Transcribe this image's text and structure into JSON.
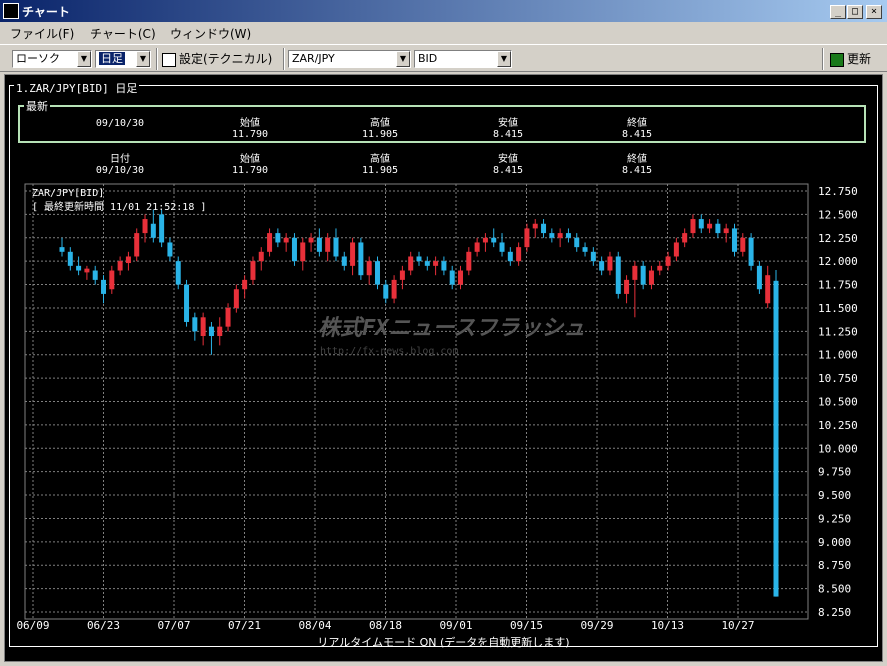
{
  "window": {
    "title": "チャート",
    "minimize": "_",
    "maximize": "□",
    "close": "×"
  },
  "menu": [
    {
      "label": "ファイル(F)"
    },
    {
      "label": "チャート(C)"
    },
    {
      "label": "ウィンドウ(W)"
    }
  ],
  "toolbar": {
    "chart_type": "ローソク",
    "period": "日足",
    "settings_label": "設定(テクニカル)",
    "pair": "ZAR/JPY",
    "price_type": "BID",
    "refresh_label": "更新"
  },
  "chart_header": "1.ZAR/JPY[BID] 日足",
  "latest": {
    "label": "最新",
    "date": "09/10/30",
    "open_label": "始値",
    "open": "11.790",
    "high_label": "高値",
    "high": "11.905",
    "low_label": "安値",
    "low": "8.415",
    "close_label": "終値",
    "close": "8.415"
  },
  "cursor_info": {
    "date_label": "日付",
    "date": "09/10/30",
    "open_label": "始値",
    "open": "11.790",
    "high_label": "高値",
    "high": "11.905",
    "low_label": "安値",
    "low": "8.415",
    "close_label": "終値",
    "close": "8.415"
  },
  "plot": {
    "symbol_label": "ZAR/JPY[BID]",
    "update_time": "[ 最終更新時間 11/01 21:52:18 ]",
    "watermark": "株式FXニュースフラッシュ",
    "watermark_url": "http://fx-news.blog.com"
  },
  "status_bar": "リアルタイムモード ON (データを自動更新します)",
  "colors": {
    "up": "#e8303a",
    "down": "#2ab4e8",
    "grid": "#808080",
    "axis_text": "#ffffff"
  },
  "chart_data": {
    "type": "candlestick",
    "ylim": [
      8.25,
      12.75
    ],
    "y_ticks": [
      "12.750",
      "12.500",
      "12.250",
      "12.000",
      "11.750",
      "11.500",
      "11.250",
      "11.000",
      "10.750",
      "10.500",
      "10.250",
      "10.000",
      "9.750",
      "9.500",
      "9.250",
      "9.000",
      "8.750",
      "8.500",
      "8.250"
    ],
    "x_ticks": [
      "06/09",
      "06/23",
      "07/07",
      "07/21",
      "08/04",
      "08/18",
      "09/01",
      "09/15",
      "09/29",
      "10/13",
      "10/27"
    ],
    "candles": [
      {
        "o": 12.15,
        "h": 12.25,
        "l": 12.05,
        "c": 12.1
      },
      {
        "o": 12.1,
        "h": 12.15,
        "l": 11.9,
        "c": 11.95
      },
      {
        "o": 11.95,
        "h": 12.05,
        "l": 11.85,
        "c": 11.9
      },
      {
        "o": 11.88,
        "h": 11.95,
        "l": 11.8,
        "c": 11.92
      },
      {
        "o": 11.9,
        "h": 11.95,
        "l": 11.75,
        "c": 11.8
      },
      {
        "o": 11.8,
        "h": 11.85,
        "l": 11.55,
        "c": 11.65
      },
      {
        "o": 11.7,
        "h": 11.95,
        "l": 11.65,
        "c": 11.9
      },
      {
        "o": 11.9,
        "h": 12.05,
        "l": 11.85,
        "c": 12.0
      },
      {
        "o": 11.98,
        "h": 12.1,
        "l": 11.9,
        "c": 12.05
      },
      {
        "o": 12.05,
        "h": 12.35,
        "l": 12.0,
        "c": 12.3
      },
      {
        "o": 12.3,
        "h": 12.5,
        "l": 12.2,
        "c": 12.45
      },
      {
        "o": 12.4,
        "h": 12.55,
        "l": 12.2,
        "c": 12.25
      },
      {
        "o": 12.5,
        "h": 12.55,
        "l": 12.15,
        "c": 12.2
      },
      {
        "o": 12.2,
        "h": 12.25,
        "l": 12.0,
        "c": 12.05
      },
      {
        "o": 12.0,
        "h": 12.05,
        "l": 11.7,
        "c": 11.75
      },
      {
        "o": 11.75,
        "h": 11.8,
        "l": 11.3,
        "c": 11.35
      },
      {
        "o": 11.4,
        "h": 11.45,
        "l": 11.15,
        "c": 11.25
      },
      {
        "o": 11.2,
        "h": 11.45,
        "l": 11.1,
        "c": 11.4
      },
      {
        "o": 11.3,
        "h": 11.35,
        "l": 11.0,
        "c": 11.2
      },
      {
        "o": 11.2,
        "h": 11.4,
        "l": 11.1,
        "c": 11.3
      },
      {
        "o": 11.3,
        "h": 11.55,
        "l": 11.25,
        "c": 11.5
      },
      {
        "o": 11.5,
        "h": 11.75,
        "l": 11.45,
        "c": 11.7
      },
      {
        "o": 11.7,
        "h": 11.85,
        "l": 11.6,
        "c": 11.8
      },
      {
        "o": 11.8,
        "h": 12.05,
        "l": 11.75,
        "c": 12.0
      },
      {
        "o": 12.0,
        "h": 12.15,
        "l": 11.9,
        "c": 12.1
      },
      {
        "o": 12.1,
        "h": 12.35,
        "l": 12.05,
        "c": 12.3
      },
      {
        "o": 12.3,
        "h": 12.35,
        "l": 12.15,
        "c": 12.2
      },
      {
        "o": 12.2,
        "h": 12.3,
        "l": 12.1,
        "c": 12.25
      },
      {
        "o": 12.25,
        "h": 12.3,
        "l": 11.95,
        "c": 12.0
      },
      {
        "o": 12.0,
        "h": 12.25,
        "l": 11.9,
        "c": 12.2
      },
      {
        "o": 12.2,
        "h": 12.3,
        "l": 12.1,
        "c": 12.25
      },
      {
        "o": 12.25,
        "h": 12.35,
        "l": 12.05,
        "c": 12.1
      },
      {
        "o": 12.1,
        "h": 12.3,
        "l": 12.0,
        "c": 12.25
      },
      {
        "o": 12.25,
        "h": 12.35,
        "l": 12.0,
        "c": 12.05
      },
      {
        "o": 12.05,
        "h": 12.1,
        "l": 11.9,
        "c": 11.95
      },
      {
        "o": 11.95,
        "h": 12.25,
        "l": 11.85,
        "c": 12.2
      },
      {
        "o": 12.2,
        "h": 12.25,
        "l": 11.8,
        "c": 11.85
      },
      {
        "o": 11.85,
        "h": 12.05,
        "l": 11.75,
        "c": 12.0
      },
      {
        "o": 12.0,
        "h": 12.05,
        "l": 11.7,
        "c": 11.75
      },
      {
        "o": 11.75,
        "h": 11.8,
        "l": 11.55,
        "c": 11.6
      },
      {
        "o": 11.6,
        "h": 11.85,
        "l": 11.55,
        "c": 11.8
      },
      {
        "o": 11.8,
        "h": 11.95,
        "l": 11.7,
        "c": 11.9
      },
      {
        "o": 11.9,
        "h": 12.1,
        "l": 11.85,
        "c": 12.05
      },
      {
        "o": 12.05,
        "h": 12.1,
        "l": 11.95,
        "c": 12.0
      },
      {
        "o": 12.0,
        "h": 12.05,
        "l": 11.9,
        "c": 11.95
      },
      {
        "o": 11.95,
        "h": 12.05,
        "l": 11.85,
        "c": 12.0
      },
      {
        "o": 12.0,
        "h": 12.05,
        "l": 11.85,
        "c": 11.9
      },
      {
        "o": 11.9,
        "h": 11.95,
        "l": 11.7,
        "c": 11.75
      },
      {
        "o": 11.75,
        "h": 11.95,
        "l": 11.7,
        "c": 11.9
      },
      {
        "o": 11.9,
        "h": 12.15,
        "l": 11.85,
        "c": 12.1
      },
      {
        "o": 12.1,
        "h": 12.25,
        "l": 12.05,
        "c": 12.2
      },
      {
        "o": 12.2,
        "h": 12.3,
        "l": 12.1,
        "c": 12.25
      },
      {
        "o": 12.25,
        "h": 12.35,
        "l": 12.15,
        "c": 12.2
      },
      {
        "o": 12.2,
        "h": 12.3,
        "l": 12.05,
        "c": 12.1
      },
      {
        "o": 12.1,
        "h": 12.15,
        "l": 11.95,
        "c": 12.0
      },
      {
        "o": 12.0,
        "h": 12.2,
        "l": 11.95,
        "c": 12.15
      },
      {
        "o": 12.15,
        "h": 12.4,
        "l": 12.1,
        "c": 12.35
      },
      {
        "o": 12.35,
        "h": 12.45,
        "l": 12.25,
        "c": 12.4
      },
      {
        "o": 12.4,
        "h": 12.45,
        "l": 12.25,
        "c": 12.3
      },
      {
        "o": 12.3,
        "h": 12.35,
        "l": 12.2,
        "c": 12.25
      },
      {
        "o": 12.25,
        "h": 12.35,
        "l": 12.15,
        "c": 12.3
      },
      {
        "o": 12.3,
        "h": 12.35,
        "l": 12.2,
        "c": 12.25
      },
      {
        "o": 12.25,
        "h": 12.3,
        "l": 12.1,
        "c": 12.15
      },
      {
        "o": 12.15,
        "h": 12.2,
        "l": 12.05,
        "c": 12.1
      },
      {
        "o": 12.1,
        "h": 12.15,
        "l": 11.95,
        "c": 12.0
      },
      {
        "o": 12.0,
        "h": 12.05,
        "l": 11.85,
        "c": 11.9
      },
      {
        "o": 11.9,
        "h": 12.1,
        "l": 11.85,
        "c": 12.05
      },
      {
        "o": 12.05,
        "h": 12.1,
        "l": 11.6,
        "c": 11.65
      },
      {
        "o": 11.65,
        "h": 11.85,
        "l": 11.55,
        "c": 11.8
      },
      {
        "o": 11.8,
        "h": 12.0,
        "l": 11.4,
        "c": 11.95
      },
      {
        "o": 11.95,
        "h": 12.0,
        "l": 11.7,
        "c": 11.75
      },
      {
        "o": 11.75,
        "h": 11.95,
        "l": 11.7,
        "c": 11.9
      },
      {
        "o": 11.9,
        "h": 12.0,
        "l": 11.85,
        "c": 11.95
      },
      {
        "o": 11.95,
        "h": 12.1,
        "l": 11.9,
        "c": 12.05
      },
      {
        "o": 12.05,
        "h": 12.25,
        "l": 12.0,
        "c": 12.2
      },
      {
        "o": 12.2,
        "h": 12.35,
        "l": 12.15,
        "c": 12.3
      },
      {
        "o": 12.3,
        "h": 12.5,
        "l": 12.25,
        "c": 12.45
      },
      {
        "o": 12.45,
        "h": 12.5,
        "l": 12.3,
        "c": 12.35
      },
      {
        "o": 12.35,
        "h": 12.45,
        "l": 12.3,
        "c": 12.4
      },
      {
        "o": 12.4,
        "h": 12.45,
        "l": 12.25,
        "c": 12.3
      },
      {
        "o": 12.3,
        "h": 12.4,
        "l": 12.2,
        "c": 12.35
      },
      {
        "o": 12.35,
        "h": 12.4,
        "l": 12.05,
        "c": 12.1
      },
      {
        "o": 12.1,
        "h": 12.3,
        "l": 12.05,
        "c": 12.25
      },
      {
        "o": 12.25,
        "h": 12.3,
        "l": 11.9,
        "c": 11.95
      },
      {
        "o": 11.95,
        "h": 12.0,
        "l": 11.65,
        "c": 11.7
      },
      {
        "o": 11.55,
        "h": 11.95,
        "l": 11.5,
        "c": 11.85
      },
      {
        "o": 11.79,
        "h": 11.905,
        "l": 8.415,
        "c": 8.415
      }
    ]
  }
}
